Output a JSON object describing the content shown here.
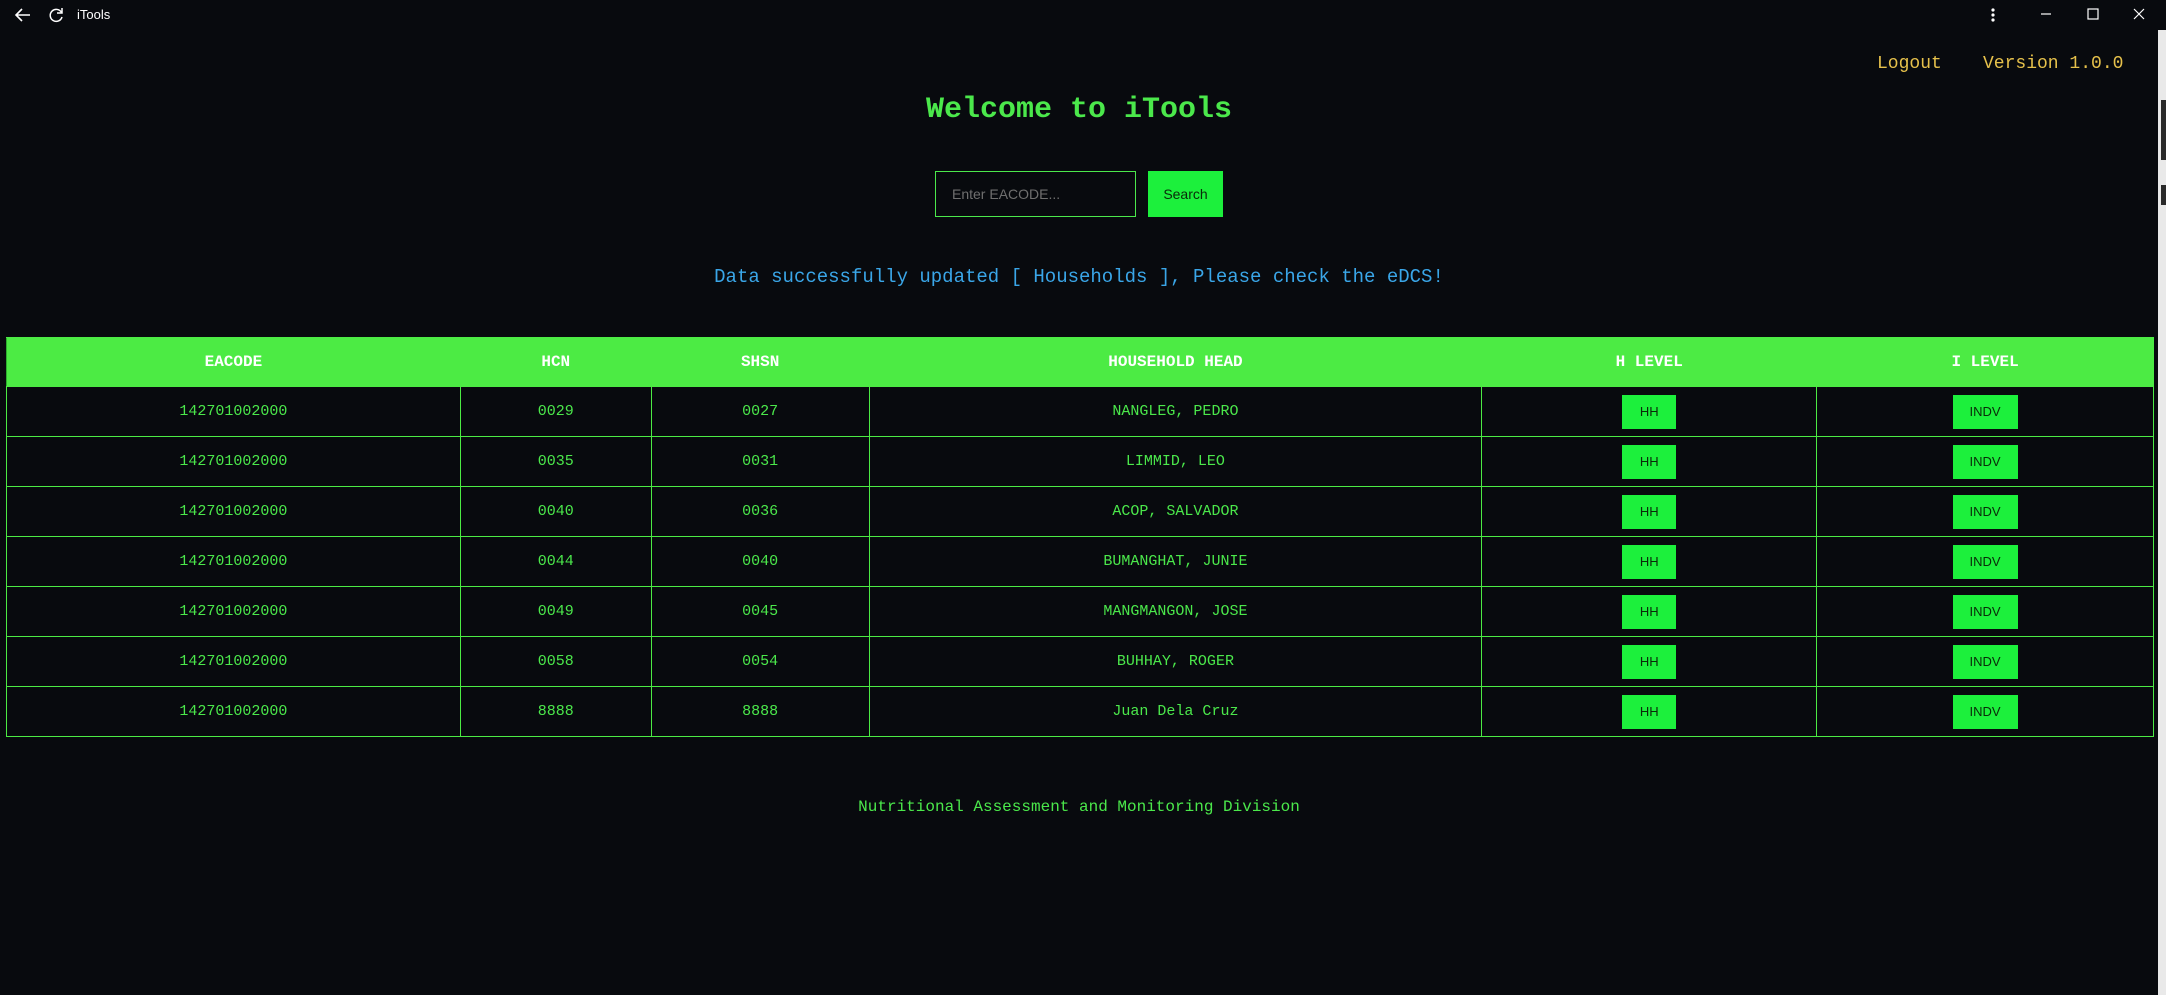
{
  "window": {
    "title": "iTools",
    "back_icon": "arrow-left-icon",
    "refresh_icon": "refresh-icon",
    "more_icon": "more-vertical-icon",
    "minimize_icon": "minimize-icon",
    "maximize_icon": "maximize-icon",
    "close_icon": "close-icon"
  },
  "header": {
    "logout_label": "Logout",
    "version_label": "Version 1.0.0"
  },
  "main": {
    "title": "Welcome to iTools",
    "search": {
      "value": "",
      "placeholder": "Enter EACODE...",
      "button_label": "Search"
    },
    "status_message": "Data successfully updated [ Households ], Please check the eDCS!"
  },
  "table": {
    "columns": [
      "EACODE",
      "HCN",
      "SHSN",
      "HOUSEHOLD HEAD",
      "H LEVEL",
      "I LEVEL"
    ],
    "rows": [
      {
        "eacode": "142701002000",
        "hcn": "0029",
        "shsn": "0027",
        "head": "NANGLEG, PEDRO",
        "h_level": "HH",
        "i_level": "INDV"
      },
      {
        "eacode": "142701002000",
        "hcn": "0035",
        "shsn": "0031",
        "head": "LIMMID, LEO",
        "h_level": "HH",
        "i_level": "INDV"
      },
      {
        "eacode": "142701002000",
        "hcn": "0040",
        "shsn": "0036",
        "head": "ACOP, SALVADOR",
        "h_level": "HH",
        "i_level": "INDV"
      },
      {
        "eacode": "142701002000",
        "hcn": "0044",
        "shsn": "0040",
        "head": "BUMANGHAT, JUNIE",
        "h_level": "HH",
        "i_level": "INDV"
      },
      {
        "eacode": "142701002000",
        "hcn": "0049",
        "shsn": "0045",
        "head": "MANGMANGON, JOSE",
        "h_level": "HH",
        "i_level": "INDV"
      },
      {
        "eacode": "142701002000",
        "hcn": "0058",
        "shsn": "0054",
        "head": "BUHHAY, ROGER",
        "h_level": "HH",
        "i_level": "INDV"
      },
      {
        "eacode": "142701002000",
        "hcn": "8888",
        "shsn": "8888",
        "head": "Juan Dela Cruz",
        "h_level": "HH",
        "i_level": "INDV"
      }
    ]
  },
  "footer": {
    "text": "Nutritional Assessment and Monitoring Division"
  },
  "colors": {
    "background": "#080a0e",
    "accent_green": "#4be84b",
    "button_green": "#1cf03c",
    "header_link": "#e6c14b",
    "status_blue": "#3aa6e8"
  }
}
